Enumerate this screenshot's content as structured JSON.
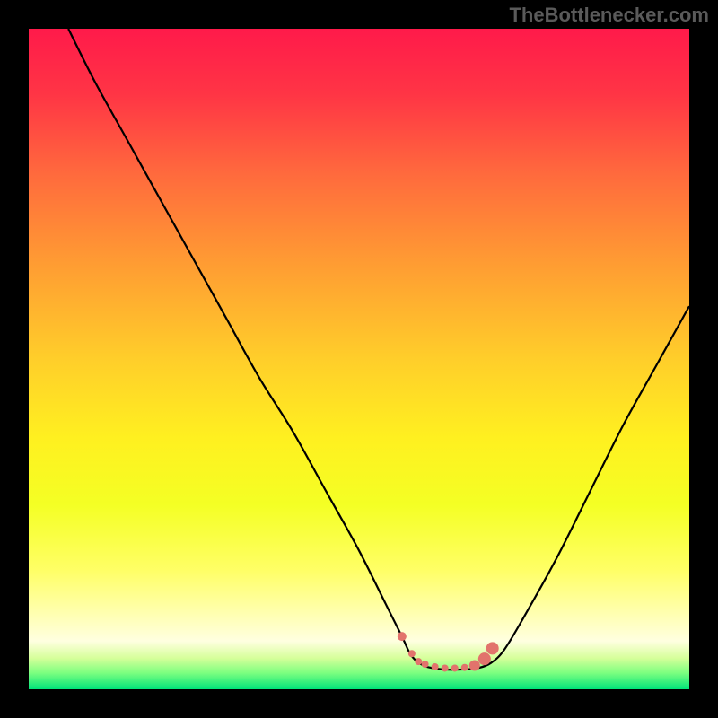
{
  "attribution": "TheBottlenecker.com",
  "colors": {
    "frame": "#000000",
    "curve": "#000000",
    "marker": "#e2736c"
  },
  "gradient_stops": [
    {
      "offset": 0.0,
      "color": "#ff1a4a"
    },
    {
      "offset": 0.1,
      "color": "#ff3545"
    },
    {
      "offset": 0.22,
      "color": "#ff6a3d"
    },
    {
      "offset": 0.35,
      "color": "#ff9a33"
    },
    {
      "offset": 0.5,
      "color": "#ffce2a"
    },
    {
      "offset": 0.62,
      "color": "#fff020"
    },
    {
      "offset": 0.72,
      "color": "#f4ff24"
    },
    {
      "offset": 0.82,
      "color": "#ffff66"
    },
    {
      "offset": 0.885,
      "color": "#ffffb0"
    },
    {
      "offset": 0.927,
      "color": "#ffffe0"
    },
    {
      "offset": 0.953,
      "color": "#d6ff9a"
    },
    {
      "offset": 0.975,
      "color": "#7dff80"
    },
    {
      "offset": 1.0,
      "color": "#00e47a"
    }
  ],
  "chart_data": {
    "type": "line",
    "title": "",
    "xlabel": "",
    "ylabel": "",
    "xlim": [
      0,
      100
    ],
    "ylim": [
      0,
      100
    ],
    "series": [
      {
        "name": "bottleneck-curve",
        "x": [
          6,
          10,
          15,
          20,
          25,
          30,
          35,
          40,
          45,
          50,
          54,
          56.5,
          58,
          60,
          63,
          66,
          68,
          70,
          72,
          75,
          80,
          85,
          90,
          95,
          100
        ],
        "y": [
          100,
          92,
          83,
          74,
          65,
          56,
          47,
          39,
          30,
          21,
          13,
          8,
          5,
          3.5,
          3,
          3,
          3.2,
          4,
          6,
          11,
          20,
          30,
          40,
          49,
          58
        ]
      }
    ],
    "markers": {
      "name": "valley-highlight",
      "color": "#e2736c",
      "points": [
        {
          "x": 56.5,
          "y": 8,
          "r": 5
        },
        {
          "x": 58,
          "y": 5.4,
          "r": 4
        },
        {
          "x": 59,
          "y": 4.2,
          "r": 4
        },
        {
          "x": 60,
          "y": 3.8,
          "r": 4
        },
        {
          "x": 61.5,
          "y": 3.4,
          "r": 4
        },
        {
          "x": 63,
          "y": 3.2,
          "r": 4
        },
        {
          "x": 64.5,
          "y": 3.2,
          "r": 4
        },
        {
          "x": 66,
          "y": 3.3,
          "r": 4
        },
        {
          "x": 67.5,
          "y": 3.6,
          "r": 6
        },
        {
          "x": 69,
          "y": 4.6,
          "r": 7
        },
        {
          "x": 70.2,
          "y": 6.2,
          "r": 7
        }
      ]
    }
  }
}
